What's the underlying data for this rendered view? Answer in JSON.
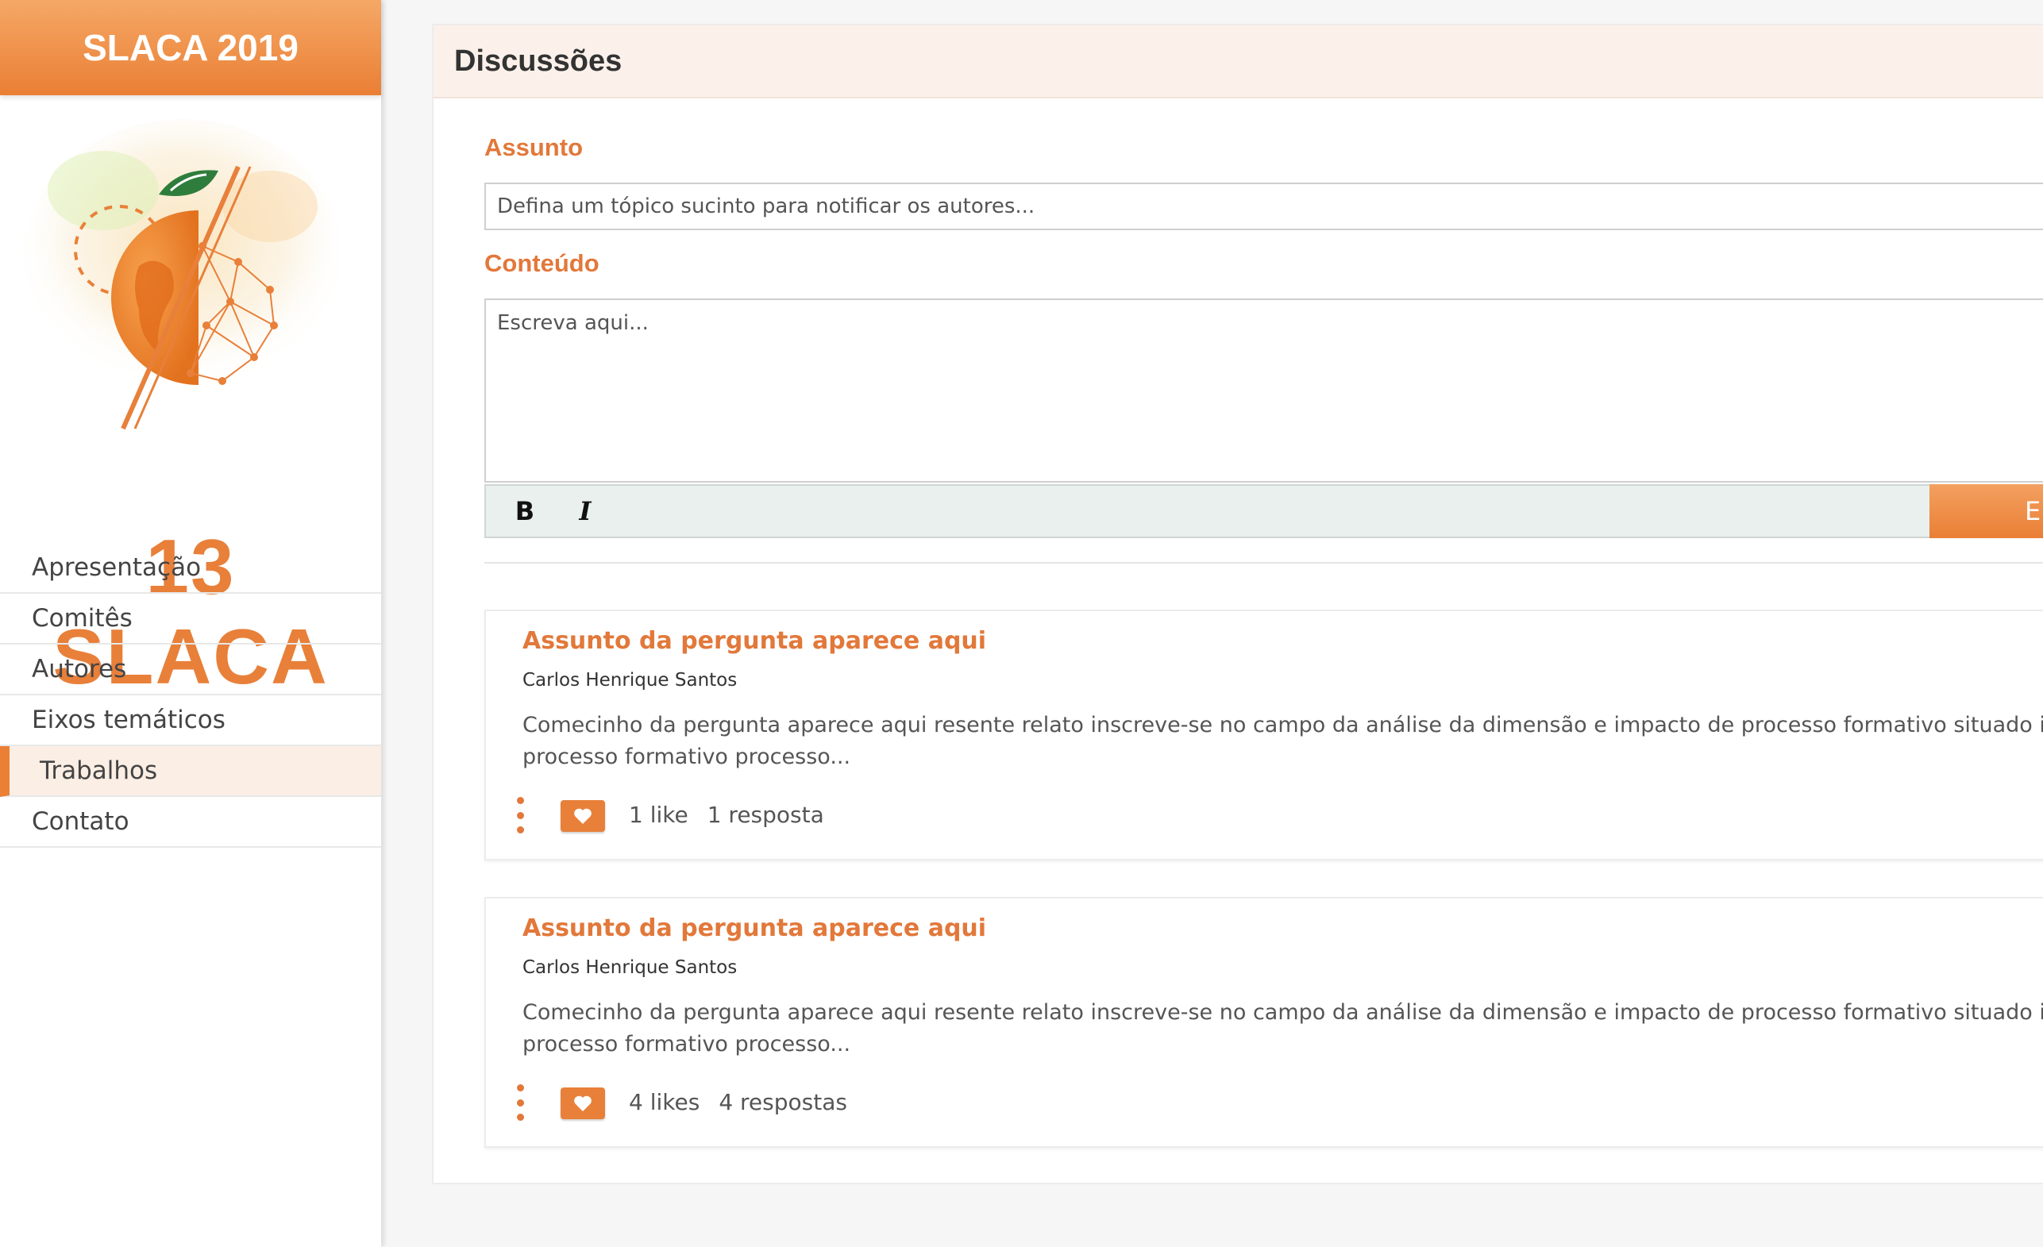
{
  "sidebar": {
    "brand": "SLACA 2019",
    "logo_text": "13 SLACA",
    "nav": [
      {
        "label": "Apresentação"
      },
      {
        "label": "Comitês"
      },
      {
        "label": "Autores"
      },
      {
        "label": "Eixos temáticos"
      },
      {
        "label": "Trabalhos",
        "active": true
      },
      {
        "label": "Contato"
      }
    ]
  },
  "panel": {
    "title": "Discussões",
    "subject_label": "Assunto",
    "subject_placeholder": "Defina um tópico sucinto para notificar os autores...",
    "content_label": "Conteúdo",
    "content_placeholder": "Escreva aqui...",
    "bold_label": "B",
    "italic_label": "I",
    "send_label": "Er"
  },
  "discussions": [
    {
      "title": "Assunto da pergunta aparece aqui",
      "author": "Carlos Henrique Santos",
      "body": "Comecinho da pergunta aparece aqui resente relato inscreve-se no campo da análise da dimensão e impacto de processo formativo situado impac\nprocesso formativo processo...",
      "likes": "1 like",
      "replies": "1 resposta"
    },
    {
      "title": "Assunto da pergunta aparece aqui",
      "author": "Carlos Henrique Santos",
      "body": "Comecinho da pergunta aparece aqui resente relato inscreve-se no campo da análise da dimensão e impacto de processo formativo situado impac\nprocesso formativo processo...",
      "likes": "4 likes",
      "replies": "4 respostas"
    }
  ],
  "colors": {
    "accent": "#ea7f35",
    "active_bg": "#fbeee4",
    "header_bg": "#fcf1ea",
    "toolbar_bg": "#e9f0ee"
  },
  "icons": {
    "like": "heart-icon",
    "menu": "more-vertical-icon",
    "logo": "orange-globe-network-logo"
  }
}
